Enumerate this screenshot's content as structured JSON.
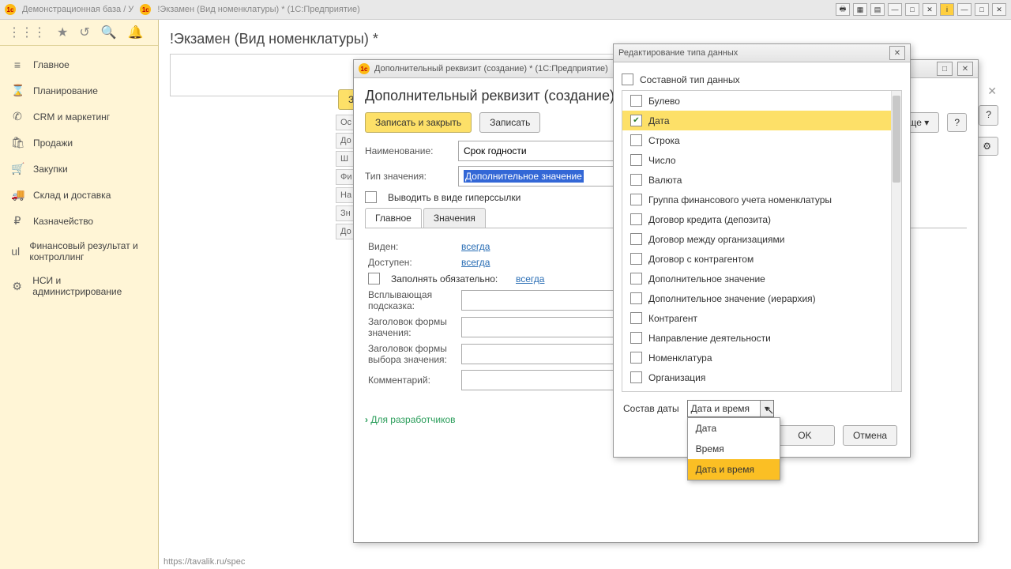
{
  "titlebar": {
    "t1": "Демонстрационная база / У",
    "t2": "!Экзамен (Вид номенклатуры) *  (1С:Предприятие)"
  },
  "sidebar": {
    "items": [
      {
        "icon": "≡",
        "label": "Главное"
      },
      {
        "icon": "⌛",
        "label": "Планирование"
      },
      {
        "icon": "✆",
        "label": "CRM и маркетинг"
      },
      {
        "icon": "🛍",
        "label": "Продажи"
      },
      {
        "icon": "🛒",
        "label": "Закупки"
      },
      {
        "icon": "🚚",
        "label": "Склад и доставка"
      },
      {
        "icon": "₽",
        "label": "Казначейство"
      },
      {
        "icon": "ul",
        "label": "Финансовый результат и контроллинг"
      },
      {
        "icon": "⚙",
        "label": "НСИ и администрирование"
      }
    ]
  },
  "page": {
    "title": "!Экзамен (Вид номенклатуры) *",
    "more": "Еще",
    "help": "?",
    "url": "https://tavalik.ru/spec"
  },
  "backtabs": [
    "Ос",
    "До",
    "Ш",
    "Фи",
    "На",
    "Зн",
    "До"
  ],
  "form": {
    "winTitle": "Дополнительный реквизит (создание) *  (1С:Предприятие)",
    "h": "Дополнительный реквизит (создание)",
    "save_close": "Записать и закрыть",
    "save": "Записать",
    "name_lbl": "Наименование:",
    "name_val": "Срок годности",
    "type_lbl": "Тип значения:",
    "type_val": "Дополнительное значение",
    "hyper": "Выводить в виде гиперссылки",
    "tabs": [
      "Главное",
      "Значения"
    ],
    "visible": "Виден:",
    "access": "Доступен:",
    "always": "всегда",
    "fill": "Заполнять обязательно:",
    "tooltip": "Всплывающая подсказка:",
    "head_val": "Заголовок формы значения:",
    "head_sel": "Заголовок формы выбора значения:",
    "comment": "Комментарий:",
    "dev": "Для разработчиков",
    "partial": "За"
  },
  "typedlg": {
    "title": "Редактирование типа данных",
    "composite": "Составной тип данных",
    "types": [
      "Булево",
      "Дата",
      "Строка",
      "Число",
      "Валюта",
      "Группа финансового учета номенклатуры",
      "Договор кредита (депозита)",
      "Договор между организациями",
      "Договор с контрагентом",
      "Дополнительное значение",
      "Дополнительное значение (иерархия)",
      "Контрагент",
      "Направление деятельности",
      "Номенклатура",
      "Организация"
    ],
    "checked": 1,
    "compo_lbl": "Состав даты",
    "compo_val": "Дата и время",
    "options": [
      "Дата",
      "Время",
      "Дата и время"
    ],
    "ok": "OK",
    "cancel": "Отмена"
  }
}
